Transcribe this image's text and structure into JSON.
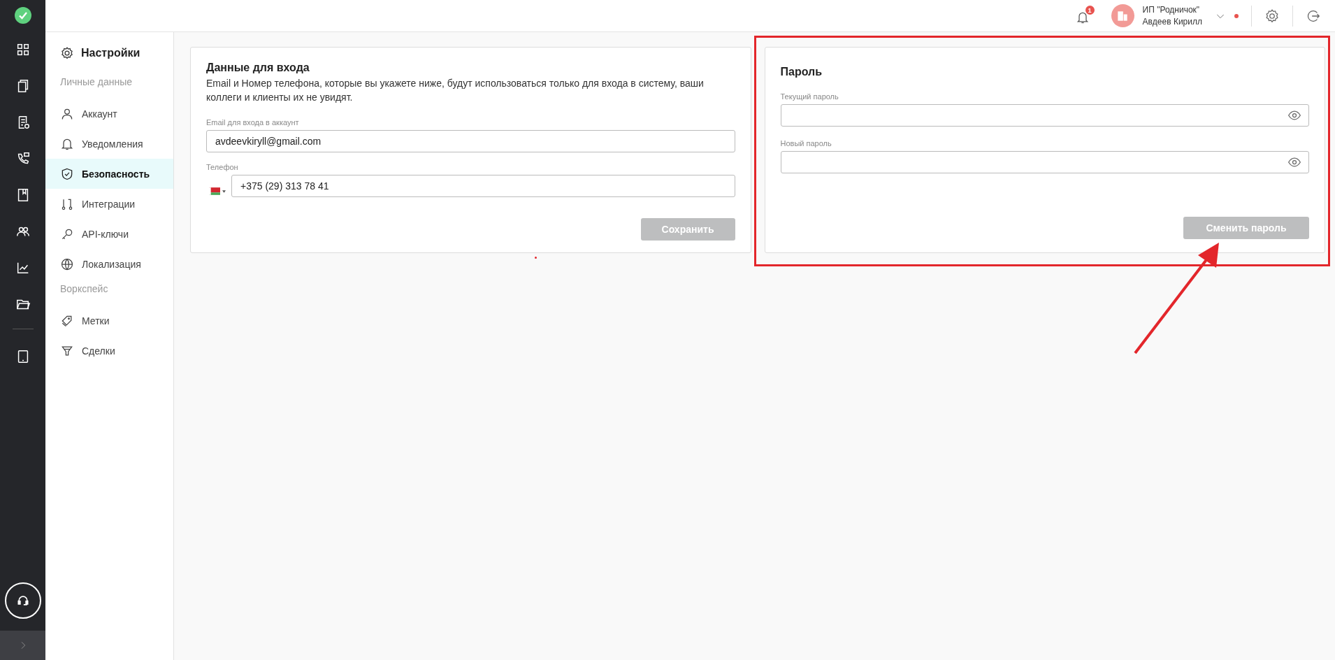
{
  "topbar": {
    "notification_count": "1",
    "company": "ИП \"Родничок\"",
    "user": "Авдеев Кирилл"
  },
  "sidebar": {
    "title": "Настройки",
    "sections": [
      {
        "heading": "Личные данные",
        "items": [
          {
            "label": "Аккаунт",
            "selected": false
          },
          {
            "label": "Уведомления",
            "selected": false
          },
          {
            "label": "Безопасность",
            "selected": true
          },
          {
            "label": "Интеграции",
            "selected": false
          },
          {
            "label": "API-ключи",
            "selected": false
          },
          {
            "label": "Локализация",
            "selected": false
          }
        ]
      },
      {
        "heading": "Воркспейс",
        "items": [
          {
            "label": "Метки",
            "selected": false
          },
          {
            "label": "Сделки",
            "selected": false
          }
        ]
      }
    ]
  },
  "login_card": {
    "title": "Данные для входа",
    "description": "Email и Номер телефона, которые вы укажете ниже, будут использоваться только для входа в систему, ваши коллеги и клиенты их не увидят.",
    "email": {
      "label": "Email для входа в аккаунт",
      "value": "avdeevkiryll@gmail.com"
    },
    "phone": {
      "label": "Телефон",
      "value": "+375 (29) 313 78 41"
    },
    "button": {
      "label": "Сохранить",
      "disabled": true
    }
  },
  "password_card": {
    "title": "Пароль",
    "fields": [
      {
        "label": "Текущий пароль"
      },
      {
        "label": "Новый пароль"
      }
    ],
    "button": {
      "label": "Сменить пароль",
      "disabled": true
    }
  }
}
